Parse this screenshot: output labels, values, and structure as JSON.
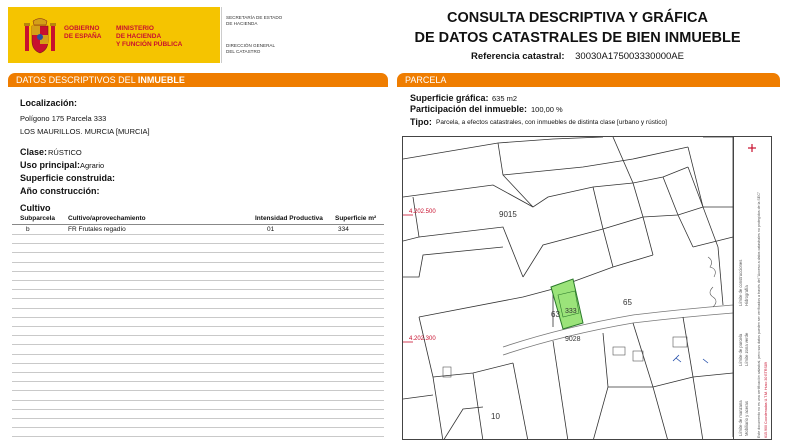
{
  "header": {
    "gobierno": "GOBIERNO DE ESPAÑA",
    "gobierno_l1": "GOBIERNO",
    "gobierno_l2": "DE ESPAÑA",
    "ministerio_l1": "MINISTERIO",
    "ministerio_l2": "DE HACIENDA",
    "ministerio_l3": "Y FUNCIÓN PÚBLICA",
    "secretaria_l1": "SECRETARÍA DE ESTADO",
    "secretaria_l2": "DE HACIENDA",
    "direccion_l1": "DIRECCIÓN GENERAL",
    "direccion_l2": "DEL CATASTRO",
    "title_l1": "CONSULTA DESCRIPTIVA Y GRÁFICA",
    "title_l2": "DE DATOS CATASTRALES DE BIEN INMUEBLE",
    "ref_label": "Referencia catastral:",
    "ref_value": "30030A175003330000AE"
  },
  "left": {
    "bar_prefix": "DATOS DESCRIPTIVOS DEL ",
    "bar_strong": "INMUEBLE",
    "localizacion_label": "Localización:",
    "localizacion_l1": "Polígono 175 Parcela 333",
    "localizacion_l2": "LOS MAURILLOS. MURCIA [MURCIA]",
    "clase_label": "Clase:",
    "clase_value": "RÚSTICO",
    "uso_label": "Uso principal:",
    "uso_value": "Agrario",
    "sup_label": "Superficie construida:",
    "ano_label": "Año construcción:",
    "cultivo_title": "Cultivo",
    "table": {
      "headers": [
        "Subparcela",
        "Cultivo/aprovechamiento",
        "Intensidad Productiva",
        "Superficie m²"
      ],
      "rows": [
        [
          "b",
          "FR Frutales regadío",
          "01",
          "334"
        ]
      ]
    }
  },
  "right": {
    "bar": "PARCELA",
    "sup_grafica_label": "Superficie gráfica:",
    "sup_grafica_value": "635 m2",
    "participacion_label": "Participación del inmueble:",
    "participacion_value": "100,00 %",
    "tipo_label": "Tipo:",
    "tipo_value": "Parcela, a efectos catastrales, con inmuebles de distinta clase [urbano y rústico]",
    "map": {
      "coord_top": "4.202.500",
      "coord_bottom": "4.202.300",
      "labels": [
        "9015",
        "333",
        "63",
        "65",
        "9028",
        "10"
      ],
      "highlight_color": "#9be37a",
      "legend_lines": [
        "Límite de manzana",
        "Límite de parcela",
        "Límite de construcciones",
        "Mobiliario y aceras",
        "Límite zona verde",
        "Hidrografía"
      ],
      "note": "Este documento no es una certificación catastral, pero sus datos pueden ser verificados a través del \"Acceso a datos catastrales no protegidos de la SEC\"",
      "coord_note": "615.900 Coordenadas U.T.M. Huso 30 ETRS89"
    }
  }
}
